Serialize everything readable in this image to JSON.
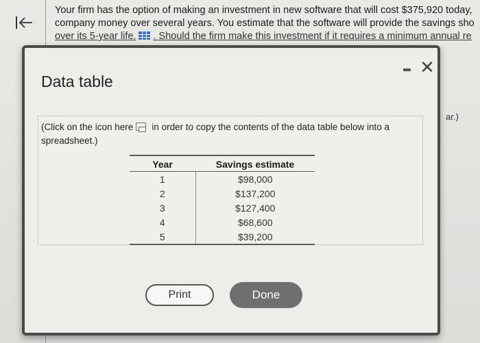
{
  "question": {
    "line1": "Your firm has the option of making an investment in new software that will cost $375,920 today,",
    "line2": "company money over several years. You estimate that the software will provide the savings sho",
    "line3_part1": "over its 5-year life.",
    "line3_part2": ". Should the firm make this investment if it requires a minimum annual re",
    "peek_text": "ar.)"
  },
  "modal": {
    "title": "Data table",
    "minimize_label": "",
    "close_label": "✕",
    "instructions_before": "(Click on the icon here",
    "instructions_after": "in order to copy the contents of the data table below into a spreadsheet.)",
    "table": {
      "headers": [
        "Year",
        "Savings estimate"
      ],
      "rows": [
        [
          "1",
          "$98,000"
        ],
        [
          "2",
          "$137,200"
        ],
        [
          "3",
          "$127,400"
        ],
        [
          "4",
          "$68,600"
        ],
        [
          "5",
          "$39,200"
        ]
      ]
    },
    "print_label": "Print",
    "done_label": "Done"
  }
}
